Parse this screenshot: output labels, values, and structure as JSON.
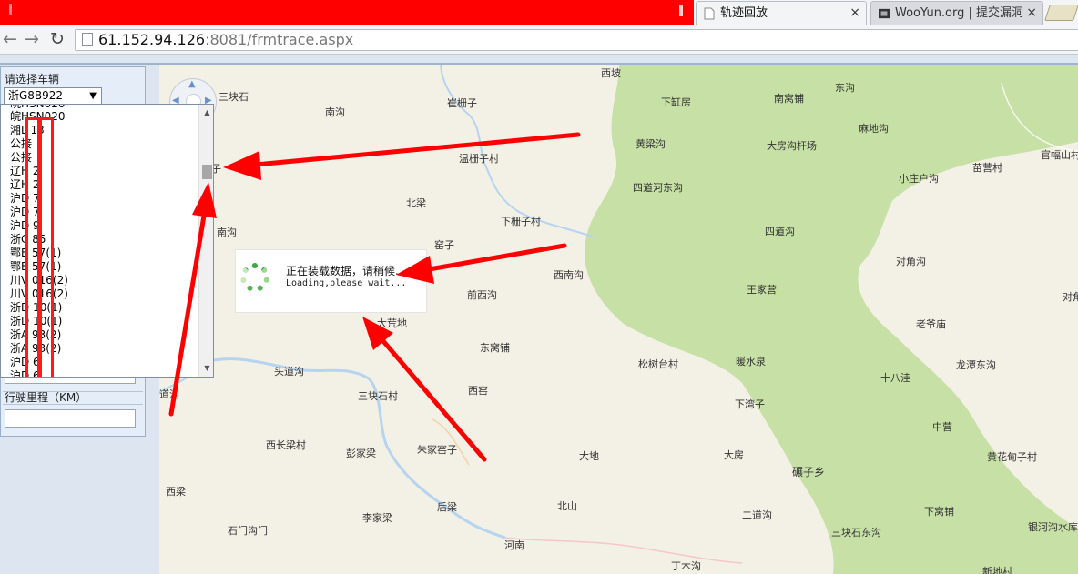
{
  "browser": {
    "tabs": [
      {
        "title": "轨迹回放",
        "active": true
      },
      {
        "title": "WooYun.org | 提交漏洞",
        "active": false
      }
    ],
    "close_glyph": "×",
    "back_glyph": "←",
    "forward_glyph": "→",
    "reload_glyph": "↻",
    "url_host": "61.152.94.126",
    "url_rest": ":8081/frmtrace.aspx"
  },
  "left_panel": {
    "select_vehicle_label": "请选择车辆",
    "selected_vehicle": "浙G8B922",
    "mileage_label": "行驶里程（KM）",
    "dropdown_options": [
      "皖HSN020",
      "湘L  13",
      "公接",
      "公接",
      "辽H    2",
      "辽H    2",
      "沪D    7",
      "沪D    7",
      "沪D    9",
      "浙C    85",
      "鄂B    57(1)",
      "鄂B    57(1)",
      "川V    016(2)",
      "川V    016(2)",
      "浙D    10(1)",
      "浙D    10(1)",
      "浙A    93(2)",
      "浙A    93(2)",
      "沪D    6",
      "沪D    6"
    ]
  },
  "map": {
    "labels": [
      {
        "text": "三块石"
      },
      {
        "text": "南沟"
      },
      {
        "text": "崔栅子"
      },
      {
        "text": "西坡"
      },
      {
        "text": "下缸房"
      },
      {
        "text": "南窝铺"
      },
      {
        "text": "东沟"
      },
      {
        "text": "麻地沟"
      },
      {
        "text": "黄梁沟"
      },
      {
        "text": "大房沟杆场"
      },
      {
        "text": "温栅子村"
      },
      {
        "text": "小庄户沟"
      },
      {
        "text": "苗营村"
      },
      {
        "text": "官幅山村"
      },
      {
        "text": "四道河东沟"
      },
      {
        "text": "北梁"
      },
      {
        "text": "下栅子村"
      },
      {
        "text": "四道沟"
      },
      {
        "text": "南沟"
      },
      {
        "text": "窑子"
      },
      {
        "text": "对角沟"
      },
      {
        "text": "西南沟"
      },
      {
        "text": "前西沟"
      },
      {
        "text": "王家营"
      },
      {
        "text": "对角"
      },
      {
        "text": "大荒地"
      },
      {
        "text": "老爷庙"
      },
      {
        "text": "东窝铺"
      },
      {
        "text": "松树台村"
      },
      {
        "text": "暖水泉"
      },
      {
        "text": "龙潭东沟"
      },
      {
        "text": "头道沟"
      },
      {
        "text": "十八洼"
      },
      {
        "text": "西窑"
      },
      {
        "text": "三块石村"
      },
      {
        "text": "下湾子"
      },
      {
        "text": "道沟"
      },
      {
        "text": "中营"
      },
      {
        "text": "西长梁村"
      },
      {
        "text": "彭家梁"
      },
      {
        "text": "朱家窑子"
      },
      {
        "text": "大地"
      },
      {
        "text": "大房"
      },
      {
        "text": "黄花甸子村"
      },
      {
        "text": "碾子乡"
      },
      {
        "text": "西梁"
      },
      {
        "text": "后梁"
      },
      {
        "text": "北山"
      },
      {
        "text": "二道沟"
      },
      {
        "text": "下窝铺"
      },
      {
        "text": "李家梁"
      },
      {
        "text": "石门沟门"
      },
      {
        "text": "三块石东沟"
      },
      {
        "text": "银河沟水库"
      },
      {
        "text": "河南"
      },
      {
        "text": "丁木沟"
      },
      {
        "text": "新地村"
      },
      {
        "text": "子"
      }
    ]
  },
  "loading": {
    "message_cn": "正在装载数据，请稍候...",
    "message_en": "Loading,please wait..."
  },
  "colors": {
    "annotation_red": "#ff0000",
    "forest_green": "#c7e0a6",
    "map_base": "#f3f0e6"
  }
}
